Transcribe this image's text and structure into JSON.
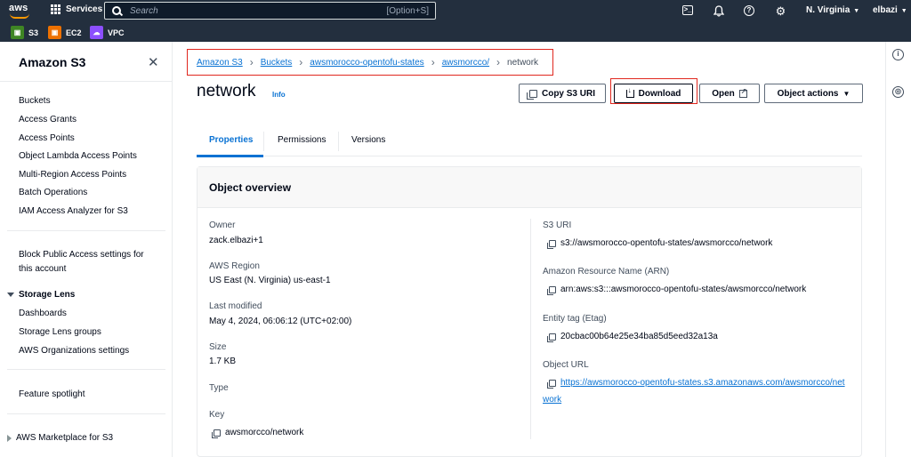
{
  "topnav": {
    "logo_text": "aws",
    "services_label": "Services",
    "search_placeholder": "Search",
    "search_shortcut": "[Option+S]",
    "region": "N. Virginia",
    "user": "elbazi"
  },
  "favorites": [
    {
      "label": "S3",
      "color": "#3f8624"
    },
    {
      "label": "EC2",
      "color": "#ed7100"
    },
    {
      "label": "VPC",
      "color": "#8c4fff"
    }
  ],
  "sidebar": {
    "title": "Amazon S3",
    "items": [
      "Buckets",
      "Access Grants",
      "Access Points",
      "Object Lambda Access Points",
      "Multi-Region Access Points",
      "Batch Operations",
      "IAM Access Analyzer for S3"
    ],
    "block_public_1": "Block Public Access settings for",
    "block_public_2": "this account",
    "storage_lens": {
      "title": "Storage Lens",
      "items": [
        "Dashboards",
        "Storage Lens groups",
        "AWS Organizations settings"
      ]
    },
    "feature_spotlight": "Feature spotlight",
    "marketplace": "AWS Marketplace for S3"
  },
  "breadcrumb": {
    "items": [
      "Amazon S3",
      "Buckets",
      "awsmorocco-opentofu-states",
      "awsmorcco/"
    ],
    "current": "network"
  },
  "page": {
    "title": "network",
    "info": "Info"
  },
  "actions": {
    "copy_uri": "Copy S3 URI",
    "download": "Download",
    "open": "Open",
    "object_actions": "Object actions"
  },
  "tabs": [
    "Properties",
    "Permissions",
    "Versions"
  ],
  "overview": {
    "title": "Object overview",
    "left": [
      {
        "label": "Owner",
        "value": "zack.elbazi+1"
      },
      {
        "label": "AWS Region",
        "value": "US East (N. Virginia) us-east-1"
      },
      {
        "label": "Last modified",
        "value": "May 4, 2024, 06:06:12 (UTC+02:00)"
      },
      {
        "label": "Size",
        "value": "1.7 KB"
      },
      {
        "label": "Type",
        "value": ""
      },
      {
        "label": "Key",
        "value": "awsmorcco/network"
      }
    ],
    "right": [
      {
        "label": "S3 URI",
        "value": "s3://awsmorocco-opentofu-states/awsmorcco/network"
      },
      {
        "label": "Amazon Resource Name (ARN)",
        "value": "arn:aws:s3:::awsmorocco-opentofu-states/awsmorcco/network"
      },
      {
        "label": "Entity tag (Etag)",
        "value": "20cbac00b64e25e34ba85d5eed32a13a"
      },
      {
        "label": "Object URL",
        "value_line1": "https://awsmorocco-opentofu-states.s3.amazonaws.com/awsmorcco/net",
        "value_line2": "work"
      }
    ]
  }
}
